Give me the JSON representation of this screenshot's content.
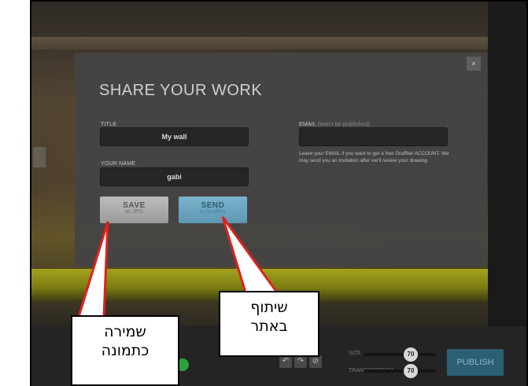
{
  "modal": {
    "title": "SHARE YOUR WORK",
    "close_label": "×",
    "title_field_label": "TITLE",
    "title_field_value": "My wall",
    "name_field_label": "YOUR NAME",
    "name_field_value": "gabi",
    "email_field_label": "EMAIL",
    "email_field_note": "(won't be published)",
    "email_field_value": "",
    "email_hint": "Leave your EMAIL if you want to get a free Graffiter ACCOUNT. We may send you an invitation after we'll review your drawing.",
    "save_button": {
      "label": "SAVE",
      "sublabel": "as JPG"
    },
    "send_button": {
      "label": "SEND",
      "sublabel": "to Graffiter"
    }
  },
  "toolbar": {
    "colors": [
      "#c9a61c",
      "#c0194a",
      "#2aa43a",
      "#2aa43a",
      "#2aa43a"
    ],
    "tool_icons": [
      "undo-icon",
      "redo-icon",
      "reset-icon"
    ],
    "size_label": "SIZE",
    "size_value": "70",
    "transparency_label": "TRANSPARENCY",
    "transparency_value": "70",
    "publish_label": "PUBLISH"
  },
  "annotations": {
    "save_callout": {
      "line1": "שמירה",
      "line2": "כתמונה"
    },
    "send_callout": {
      "line1": "שיתוף",
      "line2": "באתר"
    }
  }
}
